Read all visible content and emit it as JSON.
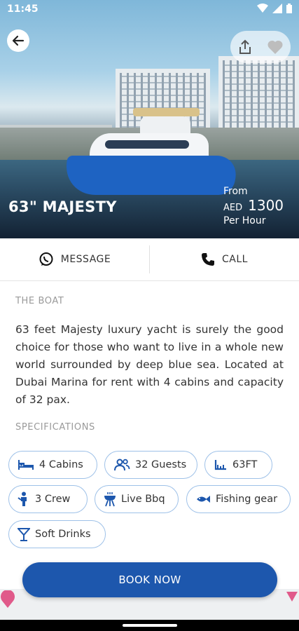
{
  "status": {
    "time": "11:45"
  },
  "hero": {
    "title": "63\" MAJESTY",
    "price_from": "From",
    "currency": "AED",
    "price": "1300",
    "price_unit": "Per Hour"
  },
  "actions": {
    "message_label": "MESSAGE",
    "call_label": "CALL"
  },
  "boat": {
    "section_label": "THE BOAT",
    "description": "63 feet Majesty luxury yacht is surely the good choice for those who want to live in a whole new world surrounded by deep blue sea. Located at Dubai Marina for rent with 4 cabins and capacity of 32 pax."
  },
  "specs": {
    "section_label": "SPECIFICATIONS",
    "items": [
      {
        "label": "4 Cabins",
        "icon": "bed-icon"
      },
      {
        "label": "32 Guests",
        "icon": "guests-icon"
      },
      {
        "label": "63FT",
        "icon": "length-icon"
      },
      {
        "label": "3 Crew",
        "icon": "crew-icon"
      },
      {
        "label": "Live Bbq",
        "icon": "bbq-icon"
      },
      {
        "label": "Fishing gear",
        "icon": "fish-icon"
      },
      {
        "label": "Soft Drinks",
        "icon": "drink-icon"
      }
    ]
  },
  "book_button": {
    "label": "BOOK NOW"
  },
  "colors": {
    "accent": "#1d57ad",
    "chip_border": "#9ec1e8",
    "icon_blue": "#1d57ad"
  }
}
